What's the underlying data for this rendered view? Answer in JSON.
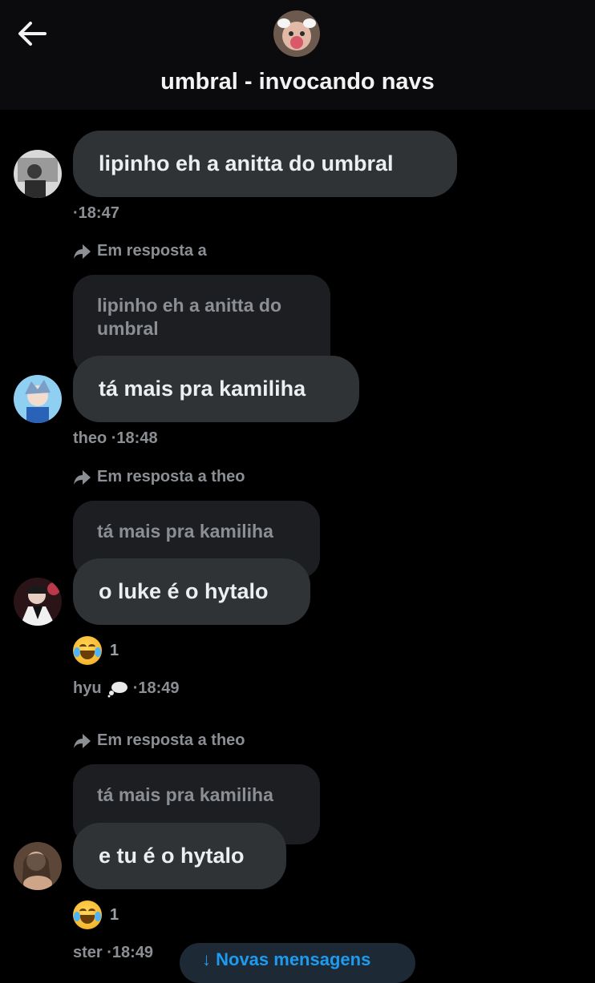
{
  "header": {
    "back_icon": "arrow-left-icon",
    "title": "umbral - invocando navs"
  },
  "messages": [
    {
      "text": "lipinho eh a anitta do umbral",
      "meta": "·18:47"
    },
    {
      "reply_label": "Em resposta a",
      "quoted": "lipinho eh a anitta do umbral",
      "text": "tá mais pra kamiliha",
      "meta": "theo ·18:48"
    },
    {
      "reply_label": "Em resposta a theo",
      "quoted": "tá mais pra kamiliha",
      "text": "o luke é o hytalo",
      "reaction": {
        "emoji": "joy-emoji",
        "count": "1"
      },
      "meta_name": "hyu",
      "meta_time": "·18:49"
    },
    {
      "reply_label": "Em resposta a theo",
      "quoted": "tá mais pra kamiliha",
      "text": "e tu é o hytalo",
      "reaction": {
        "emoji": "joy-emoji",
        "count": "1"
      },
      "meta": "ster ·18:49"
    }
  ],
  "new_messages_pill": "↓ Novas mensagens",
  "colors": {
    "background": "#000000",
    "bubble": "#2f3336",
    "quote": "#1c1e21",
    "muted_text": "#8b8f93",
    "accent": "#1d9bf0"
  }
}
